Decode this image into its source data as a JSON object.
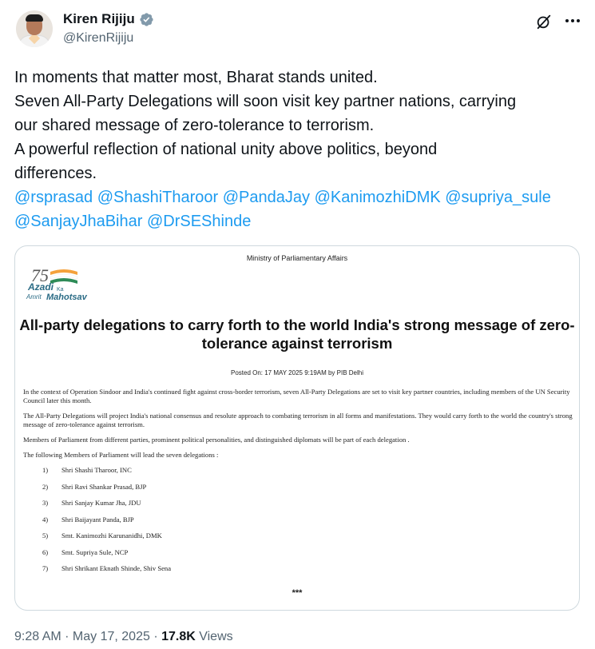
{
  "author": {
    "display_name": "Kiren Rijiju",
    "handle": "@KirenRijiju"
  },
  "tweet": {
    "lines": [
      "In moments that matter most, Bharat stands united.",
      "Seven All-Party Delegations will soon visit key partner nations, carrying",
      "our shared message of zero-tolerance to terrorism.",
      "A powerful reflection of national unity above politics, beyond",
      "differences."
    ],
    "mentions": [
      "@rsprasad",
      "@ShashiTharoor",
      "@PandaJay",
      "@KanimozhiDMK",
      "@supriya_sule",
      "@SanjayJhaBihar",
      "@DrSEShinde"
    ]
  },
  "media": {
    "ministry": "Ministry of Parliamentary Affairs",
    "logo": {
      "number": "75",
      "azadi": "Azadi",
      "ka": "Ka",
      "amrit": "Amrit",
      "mahotsav": "Mahotsav"
    },
    "title_line1": "All-party delegations to carry forth to the world India's strong message of zero-",
    "title_line2": "tolerance against terrorism",
    "posted_on": "Posted On: 17 MAY 2025 9:19AM by PIB Delhi",
    "paragraphs": [
      "In the context of Operation Sindoor and India's continued  fight against cross-border terrorism, seven  All-Party Delegations are set to  visit key partner countries, including members of the UN Security Council later this month.",
      " The All-Party Delegations will project India's national consensus and resolute approach to combating terrorism in all forms and manifestations. They would carry forth to the world the country's strong message of zero-tolerance against terrorism.",
      "Members of Parliament from different parties, prominent political personalities, and distinguished diplomats will be part of each delegation .",
      " The following Members of Parliament will lead the seven delegations :"
    ],
    "delegates": [
      {
        "num": "1)",
        "name": "Shri Shashi Tharoor, INC"
      },
      {
        "num": "2)",
        "name": "Shri Ravi Shankar Prasad, BJP"
      },
      {
        "num": "3)",
        "name": "Shri Sanjay Kumar Jha, JDU"
      },
      {
        "num": "4)",
        "name": "Shri Baijayant Panda, BJP"
      },
      {
        "num": "5)",
        "name": "Smt. Kanimozhi Karunanidhi, DMK"
      },
      {
        "num": "6)",
        "name": "Smt. Supriya Sule, NCP"
      },
      {
        "num": "7)",
        "name": "Shri Shrikant Eknath Shinde, Shiv Sena"
      }
    ],
    "ellipsis": "***"
  },
  "meta": {
    "time": "9:28 AM",
    "separator1": " · ",
    "date": "May 17, 2025",
    "separator2": " · ",
    "views_count": "17.8K",
    "views_label": " Views"
  },
  "colors": {
    "text": "#0f1419",
    "secondary": "#536471",
    "link": "#1d9bf0",
    "verified": "#829aab",
    "logo_saffron": "#f4a13b",
    "logo_green": "#2e8b57"
  },
  "icons": [
    "verified-badge-icon",
    "grok-icon",
    "more-options-icon"
  ]
}
